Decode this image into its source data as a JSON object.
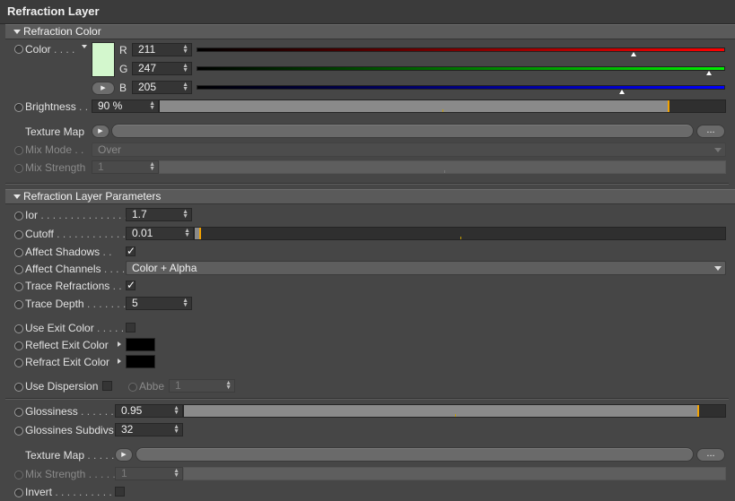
{
  "title": "Refraction Layer",
  "sections": {
    "color": "Refraction Color",
    "params": "Refraction Layer Parameters"
  },
  "color": {
    "label": "Color",
    "dots": ". . . .",
    "swatch": "#d3f7cd",
    "channels": [
      {
        "name": "R",
        "value": "211",
        "level": 0.827,
        "color": "#ff0000"
      },
      {
        "name": "G",
        "value": "247",
        "level": 0.969,
        "color": "#00ee00"
      },
      {
        "name": "B",
        "value": "205",
        "level": 0.804,
        "color": "#0000ff"
      }
    ]
  },
  "brightness": {
    "label": "Brightness",
    "dots": ". .",
    "value": "90 %",
    "level": 0.9
  },
  "texture_map_1": {
    "label": "Texture Map",
    "more": "..."
  },
  "mix_mode": {
    "label": "Mix Mode",
    "dots": ". .",
    "value": "Over"
  },
  "mix_strength_1": {
    "label": "Mix Strength",
    "value": "1"
  },
  "ior": {
    "label": "Ior",
    "dots": ". . . . . . . . . . . . . . . .",
    "value": "1.7"
  },
  "cutoff": {
    "label": "Cutoff",
    "dots": ". . . . . . . . . . . . .",
    "value": "0.01",
    "level": 0.01
  },
  "affect_shadows": {
    "label": "Affect Shadows",
    "dots": ". .",
    "checked": true
  },
  "affect_channels": {
    "label": "Affect Channels",
    "dots": ". . . .",
    "value": "Color + Alpha"
  },
  "trace_refractions": {
    "label": "Trace Refractions",
    "dots": ". .",
    "checked": true
  },
  "trace_depth": {
    "label": "Trace Depth",
    "dots": ". . . . . . .",
    "value": "5"
  },
  "use_exit_color": {
    "label": "Use Exit Color",
    "dots": ". . . . .",
    "checked": false
  },
  "reflect_exit_color": {
    "label": "Reflect Exit Color",
    "color": "#000000"
  },
  "refract_exit_color": {
    "label": "Refract Exit Color",
    "color": "#000000"
  },
  "use_dispersion": {
    "label": "Use Dispersion",
    "checked": false
  },
  "abbe": {
    "label": "Abbe",
    "value": "1"
  },
  "glossiness": {
    "label": "Glossiness",
    "dots": ". . . . . . . .",
    "value": "0.95",
    "level": 0.95
  },
  "glossines_subdivs": {
    "label": "Glossines Subdivs",
    "value": "32"
  },
  "texture_map_2": {
    "label": "Texture Map",
    "dots": ". . . . . .",
    "more": "..."
  },
  "mix_strength_2": {
    "label": "Mix Strength",
    "dots": ". . . . . .",
    "value": "1"
  },
  "invert": {
    "label": "Invert",
    "dots": ". . . . . . . . . . . .",
    "checked": false
  },
  "icons": {
    "check": "✓",
    "play": "▶",
    "spin_up": "▲",
    "spin_down": "▼"
  }
}
